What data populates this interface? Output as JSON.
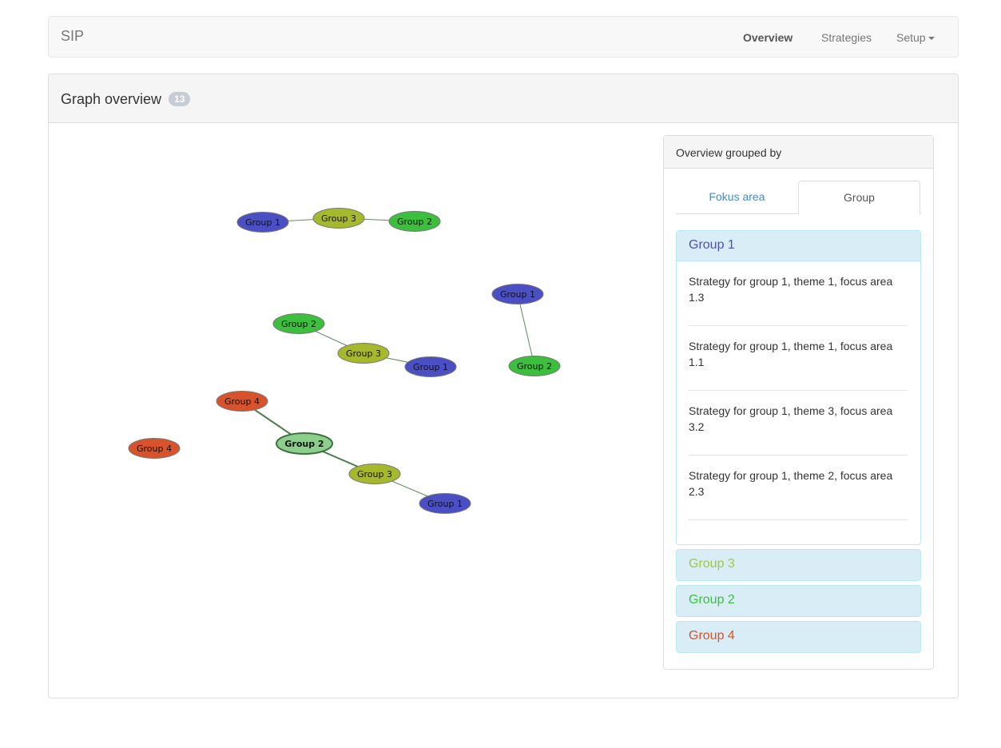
{
  "navbar": {
    "brand": "SIP",
    "items": [
      {
        "label": "Overview",
        "active": true
      },
      {
        "label": "Strategies",
        "active": false
      },
      {
        "label": "Setup",
        "active": false
      }
    ]
  },
  "panel": {
    "title": "Graph overview",
    "badge": "13"
  },
  "colors": {
    "group1": "#4a50c4",
    "group2": "#3cbf3c",
    "group3": "#a6b92c",
    "group4": "#d8522c",
    "group2_selected": "#8ccf8c"
  },
  "graph": {
    "nodes": [
      {
        "id": "a1",
        "label": "Group 1",
        "group": "group1"
      },
      {
        "id": "a3",
        "label": "Group 3",
        "group": "group3"
      },
      {
        "id": "a2",
        "label": "Group 2",
        "group": "group2"
      },
      {
        "id": "b1",
        "label": "Group 1",
        "group": "group1"
      },
      {
        "id": "b2",
        "label": "Group 2",
        "group": "group2"
      },
      {
        "id": "c2",
        "label": "Group 2",
        "group": "group2"
      },
      {
        "id": "c3",
        "label": "Group 3",
        "group": "group3"
      },
      {
        "id": "c1",
        "label": "Group 1",
        "group": "group1"
      },
      {
        "id": "d4",
        "label": "Group 4",
        "group": "group4"
      },
      {
        "id": "d2",
        "label": "Group 2",
        "group": "group2_selected",
        "selected": true
      },
      {
        "id": "d3",
        "label": "Group 3",
        "group": "group3"
      },
      {
        "id": "d1",
        "label": "Group 1",
        "group": "group1"
      },
      {
        "id": "e4",
        "label": "Group 4",
        "group": "group4"
      }
    ],
    "edges": [
      [
        "a1",
        "a3"
      ],
      [
        "a3",
        "a2"
      ],
      [
        "b1",
        "b2"
      ],
      [
        "c2",
        "c3"
      ],
      [
        "c3",
        "c1"
      ],
      [
        "d4",
        "d2"
      ],
      [
        "d2",
        "d3"
      ],
      [
        "d3",
        "d1"
      ]
    ]
  },
  "sidebar": {
    "title": "Overview grouped by",
    "tabs": [
      {
        "label": "Fokus area",
        "active": false
      },
      {
        "label": "Group",
        "active": true
      }
    ],
    "groups": [
      {
        "label": "Group 1",
        "color": "#4a50c4",
        "expanded": true,
        "strategies": [
          "Strategy for group 1, theme 1, focus area 1.3",
          "Strategy for group 1, theme 1, focus area 1.1",
          "Strategy for group 1, theme 3, focus area 3.2",
          "Strategy for group 1, theme 2, focus area 2.3"
        ]
      },
      {
        "label": "Group 3",
        "color": "#9cc93c",
        "expanded": false
      },
      {
        "label": "Group 2",
        "color": "#3cbf3c",
        "expanded": false
      },
      {
        "label": "Group 4",
        "color": "#d8522c",
        "expanded": false
      }
    ]
  }
}
